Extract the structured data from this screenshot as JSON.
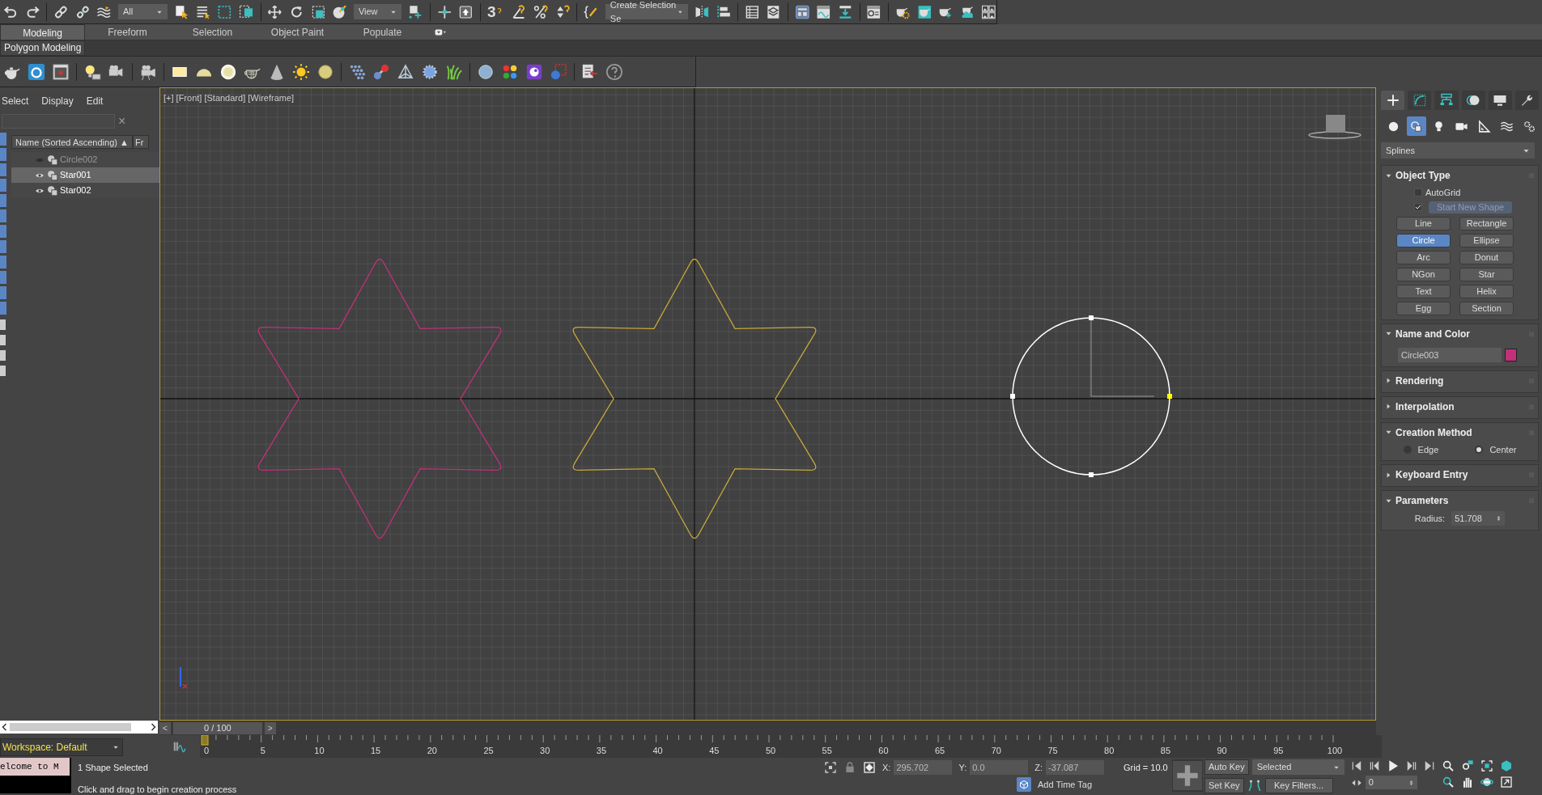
{
  "toolbar": {
    "selection_filter": "All",
    "reference_coordinate_system": "View",
    "snap_toggle_label": "3",
    "named_selection_set": "Create Selection Se"
  },
  "ribbon": {
    "tabs": [
      {
        "label": "Modeling",
        "selected": true
      },
      {
        "label": "Freeform",
        "selected": false
      },
      {
        "label": "Selection",
        "selected": false
      },
      {
        "label": "Object Paint",
        "selected": false
      },
      {
        "label": "Populate",
        "selected": false
      }
    ],
    "panel": "Polygon Modeling"
  },
  "scene_explorer": {
    "menu": [
      "Select",
      "Display",
      "Edit"
    ],
    "clear_symbol": "×",
    "columns": [
      "Name (Sorted Ascending)",
      "Fr"
    ],
    "sort_indicator": "▲",
    "items": [
      {
        "name": "Circle002",
        "visible": false,
        "selected": false
      },
      {
        "name": "Star001",
        "visible": true,
        "selected": true
      },
      {
        "name": "Star002",
        "visible": true,
        "selected": false
      }
    ]
  },
  "workspace": "Workspace: Default",
  "viewport": {
    "label": "[+] [Front] [Standard] [Wireframe]",
    "shapes": [
      {
        "kind": "star",
        "color": "#c2307a"
      },
      {
        "kind": "star",
        "color": "#c8a83a"
      },
      {
        "kind": "circle",
        "color": "#ffffff"
      }
    ]
  },
  "command_panel": {
    "tabs": [
      {
        "selected": true
      },
      {
        "selected": false
      },
      {
        "selected": false
      },
      {
        "selected": false
      },
      {
        "selected": false
      },
      {
        "selected": false
      }
    ],
    "categories": [
      {
        "selected": false
      },
      {
        "selected": true
      },
      {
        "selected": false
      },
      {
        "selected": false
      },
      {
        "selected": false
      },
      {
        "selected": false
      },
      {
        "selected": false
      }
    ],
    "category_dropdown": "Splines",
    "rollouts": [
      {
        "kind": "object_type",
        "title": "Object Type",
        "expanded": true,
        "autogrid": {
          "label": "AutoGrid",
          "checked": false
        },
        "start_new_shape": {
          "label": "Start New Shape",
          "checked": true
        },
        "buttons": [
          {
            "label": "Line",
            "selected": false
          },
          {
            "label": "Rectangle",
            "selected": false
          },
          {
            "label": "Circle",
            "selected": true
          },
          {
            "label": "Ellipse",
            "selected": false
          },
          {
            "label": "Arc",
            "selected": false
          },
          {
            "label": "Donut",
            "selected": false
          },
          {
            "label": "NGon",
            "selected": false
          },
          {
            "label": "Star",
            "selected": false
          },
          {
            "label": "Text",
            "selected": false
          },
          {
            "label": "Helix",
            "selected": false
          },
          {
            "label": "Egg",
            "selected": false
          },
          {
            "label": "Section",
            "selected": false
          }
        ]
      },
      {
        "kind": "name_color",
        "title": "Name and Color",
        "expanded": true,
        "name": "Circle003",
        "color": "#c2307a"
      },
      {
        "kind": "plain",
        "title": "Rendering",
        "expanded": false
      },
      {
        "kind": "plain",
        "title": "Interpolation",
        "expanded": false
      },
      {
        "kind": "radio",
        "title": "Creation Method",
        "expanded": true,
        "options": [
          {
            "label": "Edge",
            "selected": false
          },
          {
            "label": "Center",
            "selected": true
          }
        ]
      },
      {
        "kind": "plain",
        "title": "Keyboard Entry",
        "expanded": false
      },
      {
        "kind": "params",
        "title": "Parameters",
        "expanded": true,
        "fields": [
          {
            "label": "Radius:",
            "value": "51.708"
          }
        ]
      }
    ]
  },
  "time_slider": {
    "prev": "<",
    "position": "0 / 100",
    "next": ">"
  },
  "track_bar": {
    "frames": [
      "0",
      "5",
      "10",
      "15",
      "20",
      "25",
      "30",
      "35",
      "40",
      "45",
      "50",
      "55",
      "60",
      "65",
      "70",
      "75",
      "80",
      "85",
      "90",
      "95",
      "100"
    ],
    "level": 0
  },
  "listener": "elcome to M",
  "status": {
    "selection": "1 Shape Selected",
    "prompt": "Click and drag to begin creation process"
  },
  "coordinates": [
    {
      "axis": "X:",
      "value": "295.702"
    },
    {
      "axis": "Y:",
      "value": "0.0"
    },
    {
      "axis": "Z:",
      "value": "-37.087"
    }
  ],
  "grid": "Grid = 10.0",
  "time_tag": "Add Time Tag",
  "animation": {
    "auto_key": "Auto Key",
    "key_mode": "Selected",
    "set_key": "Set Key",
    "key_filters": "Key Filters...",
    "frame": "0"
  }
}
